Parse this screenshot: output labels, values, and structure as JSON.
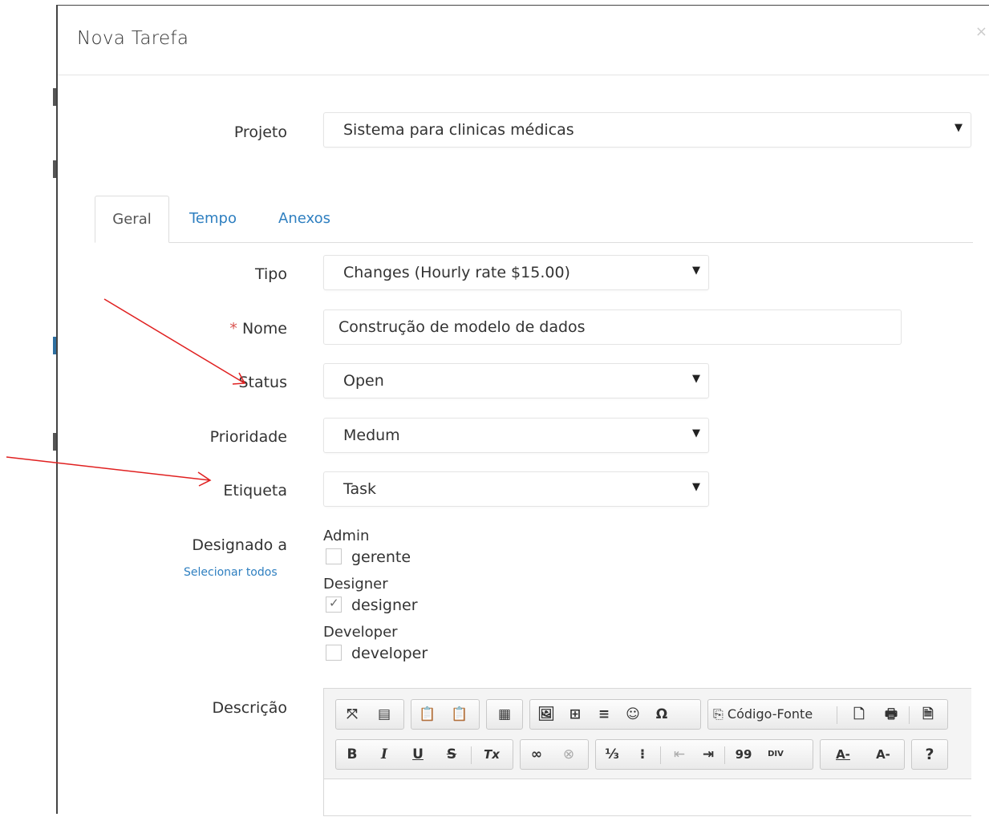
{
  "modal": {
    "title": "Nova Tarefa",
    "close": "×"
  },
  "projeto": {
    "label": "Projeto",
    "value": "Sistema para clinicas médicas"
  },
  "tabs": [
    {
      "label": "Geral",
      "active": true
    },
    {
      "label": "Tempo",
      "active": false
    },
    {
      "label": "Anexos",
      "active": false
    }
  ],
  "fields": {
    "tipo": {
      "label": "Tipo",
      "value": "Changes (Hourly rate $15.00)"
    },
    "nome": {
      "required_mark": "*",
      "label": "Nome",
      "value": "Construção de modelo de dados"
    },
    "status": {
      "label": "Status",
      "value": "Open"
    },
    "prioridade": {
      "label": "Prioridade",
      "value": "Medum"
    },
    "etiqueta": {
      "label": "Etiqueta",
      "value": "Task"
    }
  },
  "designado": {
    "label": "Designado a",
    "select_all": "Selecionar todos",
    "groups": [
      {
        "role": "Admin",
        "user": "gerente",
        "checked": false
      },
      {
        "role": "Designer",
        "user": "designer",
        "checked": true
      },
      {
        "role": "Developer",
        "user": "developer",
        "checked": false
      }
    ]
  },
  "descricao": {
    "label": "Descrição",
    "source_button": "Código-Fonte"
  },
  "icons": {
    "dropdown": "▼",
    "check": "✓",
    "maximize": "⤧",
    "show_blocks": "▤",
    "paste": "📋",
    "paste_text": "📋",
    "template": "▦",
    "image": "🖼",
    "table": "⊞",
    "hr": "≡",
    "smiley": "☺",
    "special_char": "Ω",
    "source": "⎘",
    "new_page": "🗋",
    "print": "🖶",
    "preview": "🗎",
    "bold": "B",
    "italic": "I",
    "underline": "U",
    "strike": "S",
    "remove_format": "Tx",
    "link": "∞",
    "unlink": "⊗",
    "numbered_list": "⅓",
    "bullet_list": "⁝",
    "outdent": "⇤",
    "indent": "⇥",
    "blockquote": "99",
    "div": "DIV",
    "text_color": "A-",
    "bg_color": "A-",
    "help": "?"
  },
  "colors": {
    "link": "#2e7fc0",
    "required": "#d9534f",
    "arrow": "#e02020"
  }
}
